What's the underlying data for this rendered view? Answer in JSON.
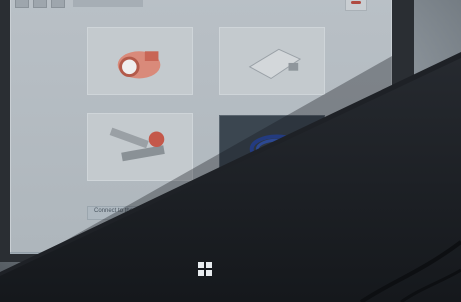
{
  "window": {
    "title": ""
  },
  "tiles": [
    {
      "name": "tile-spark-plug",
      "label": ""
    },
    {
      "name": "tile-sensor-bracket",
      "label": ""
    },
    {
      "name": "tile-mount-kit",
      "label": ""
    },
    {
      "name": "tile-usb-cable",
      "label": ""
    }
  ],
  "status_bar": {
    "text": "Connect to the vehicle ..."
  },
  "taskbar": {
    "start_icon": "windows-logo-icon"
  },
  "colors": {
    "screen_bg": "#aeb6bc",
    "bezel": "#2a2e33",
    "accent_cable": "#2b4fb5"
  }
}
